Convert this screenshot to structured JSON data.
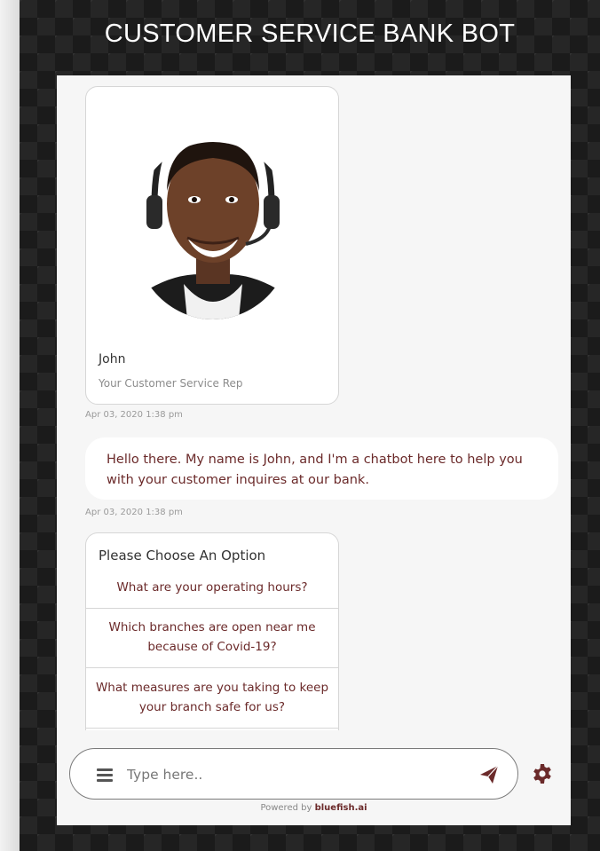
{
  "header": {
    "title": "CUSTOMER SERVICE BANK BOT"
  },
  "agent_card": {
    "name": "John",
    "role": "Your Customer Service Rep",
    "timestamp": "Apr 03, 2020 1:38 pm"
  },
  "message": {
    "text": "Hello there. My name is John, and I'm a chatbot here to help you with your customer inquires at our bank.",
    "timestamp": "Apr 03, 2020 1:38 pm"
  },
  "options": {
    "title": "Please Choose An Option",
    "items": [
      {
        "label": "What are your operating hours?"
      },
      {
        "label": "Which branches are open near me because of Covid-19?"
      },
      {
        "label": "What measures are you taking to keep your branch safe for us?"
      }
    ]
  },
  "composer": {
    "placeholder": "Type here..",
    "value": ""
  },
  "footer": {
    "powered_prefix": "Powered by",
    "brand": "bluefish.ai"
  },
  "colors": {
    "accent": "#6b2a2a",
    "background_dark": "#262626",
    "panel": "#f6f6f6"
  },
  "icons": {
    "menu": "menu-icon",
    "send": "send-icon",
    "settings": "gear-icon"
  }
}
